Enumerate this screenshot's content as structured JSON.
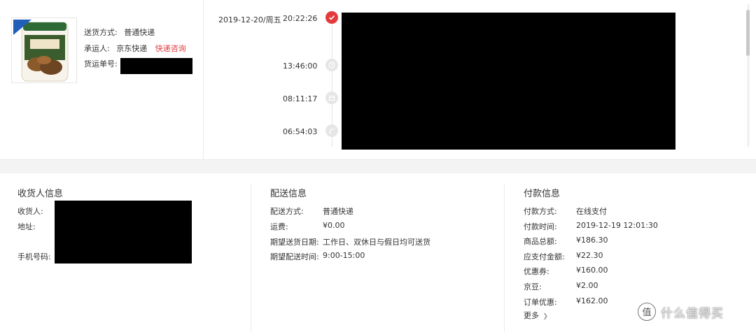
{
  "shipment": {
    "method_label": "送货方式:",
    "method_value": "普通快递",
    "carrier_label": "承运人:",
    "carrier_value": "京东快递",
    "carrier_link": "快递咨询",
    "tracking_label": "货运单号:"
  },
  "timeline": {
    "date": "2019-12-20/周五",
    "events": [
      {
        "time": "20:22:26",
        "icon": "check-icon",
        "active": true
      },
      {
        "time": "13:46:00",
        "icon": "clock-icon",
        "active": false
      },
      {
        "time": "08:11:17",
        "icon": "package-icon",
        "active": false
      },
      {
        "time": "06:54:03",
        "icon": "truck-icon",
        "active": false
      }
    ]
  },
  "receiver": {
    "title": "收货人信息",
    "name_label": "收货人:",
    "address_label": "地址:",
    "phone_label": "手机号码:"
  },
  "delivery": {
    "title": "配送信息",
    "rows": [
      {
        "label": "配送方式:",
        "value": "普通快递"
      },
      {
        "label": "运费:",
        "value": "¥0.00"
      },
      {
        "label": "期望送货日期:",
        "value": "工作日、双休日与假日均可送货"
      },
      {
        "label": "期望配送时间:",
        "value": "9:00-15:00"
      }
    ]
  },
  "payment": {
    "title": "付款信息",
    "rows": [
      {
        "label": "付款方式:",
        "value": "在线支付"
      },
      {
        "label": "付款时间:",
        "value": "2019-12-19 12:01:30"
      },
      {
        "label": "商品总额:",
        "value": "¥186.30"
      },
      {
        "label": "应支付金额:",
        "value": "¥22.30"
      },
      {
        "label": "优惠券:",
        "value": "¥160.00"
      },
      {
        "label": "京豆:",
        "value": "¥2.00"
      },
      {
        "label": "订单优惠:",
        "value": "¥162.00"
      }
    ],
    "more_label": "更多"
  },
  "watermark": {
    "text": "什么值得买",
    "icon": "zhi-logo-icon"
  },
  "colors": {
    "accent": "#e4393c",
    "band": "#f3f3f3"
  }
}
